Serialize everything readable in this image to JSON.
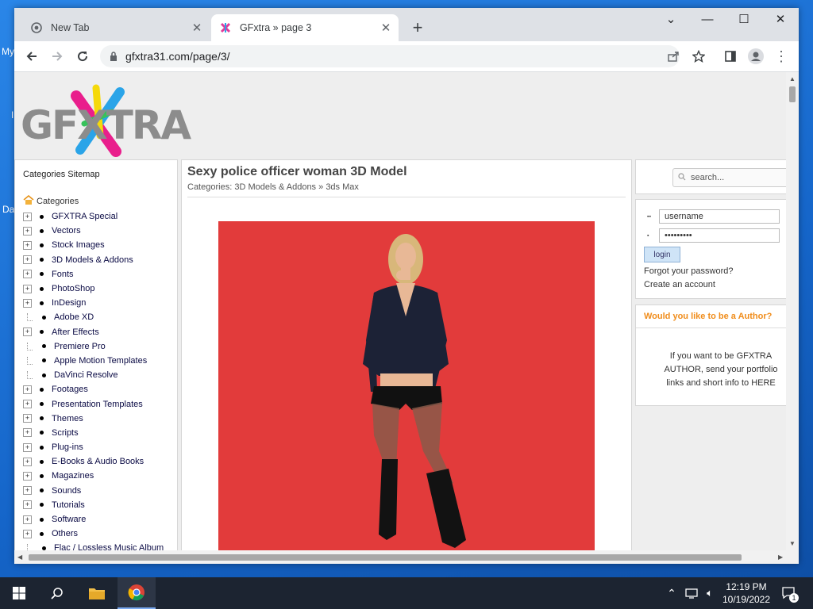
{
  "desktop": {
    "frag_top": "My",
    "frag_mid": "I",
    "frag_bottom": "Da"
  },
  "browser": {
    "tabs": [
      {
        "title": "New Tab",
        "active": false
      },
      {
        "title": "GFxtra » page 3",
        "active": true
      }
    ],
    "new_tab_label": "+",
    "url": "gfxtra31.com/page/3/"
  },
  "page": {
    "logo": "GFXTRA",
    "left": {
      "sitemap_label": "Categories Sitemap",
      "categories_label": "Categories",
      "categories": [
        {
          "label": "GFXTRA Special",
          "expandable": true
        },
        {
          "label": "Vectors",
          "expandable": true
        },
        {
          "label": "Stock Images",
          "expandable": true
        },
        {
          "label": "3D Models & Addons",
          "expandable": true
        },
        {
          "label": "Fonts",
          "expandable": true
        },
        {
          "label": "PhotoShop",
          "expandable": true
        },
        {
          "label": "InDesign",
          "expandable": true
        },
        {
          "label": "Adobe XD",
          "expandable": false
        },
        {
          "label": "After Effects",
          "expandable": true
        },
        {
          "label": "Premiere Pro",
          "expandable": false
        },
        {
          "label": "Apple Motion Templates",
          "expandable": false
        },
        {
          "label": "DaVinci Resolve",
          "expandable": false
        },
        {
          "label": "Footages",
          "expandable": true
        },
        {
          "label": "Presentation Templates",
          "expandable": true
        },
        {
          "label": "Themes",
          "expandable": true
        },
        {
          "label": "Scripts",
          "expandable": true
        },
        {
          "label": "Plug-ins",
          "expandable": true
        },
        {
          "label": "E-Books & Audio Books",
          "expandable": true
        },
        {
          "label": "Magazines",
          "expandable": true
        },
        {
          "label": "Sounds",
          "expandable": true
        },
        {
          "label": "Tutorials",
          "expandable": true
        },
        {
          "label": "Software",
          "expandable": true
        },
        {
          "label": "Others",
          "expandable": true
        },
        {
          "label": "Flac / Lossless Music Album",
          "expandable": false
        }
      ]
    },
    "post": {
      "title": "Sexy police officer woman 3D Model",
      "categories_prefix": "Categories:",
      "category_1": "3D Models & Addons",
      "separator": "»",
      "category_2": "3ds Max",
      "image_bg": "#e23b3b"
    },
    "right": {
      "search_placeholder": "search...",
      "username_value": "username",
      "password_value": "•••••••••",
      "login_label": "login",
      "forgot_label": "Forgot your password?",
      "create_label": "Create an account",
      "author_title": "Would you like to be a Author?",
      "author_text": "If you want to be GFXTRA AUTHOR, send your portfolio links and short info to HERE"
    }
  },
  "taskbar": {
    "time": "12:19 PM",
    "date": "10/19/2022",
    "notification_count": "1"
  },
  "colors": {
    "accent_orange": "#f08c1a",
    "taskbar": "#1c2431",
    "desktop_blue": "#1565c9"
  }
}
